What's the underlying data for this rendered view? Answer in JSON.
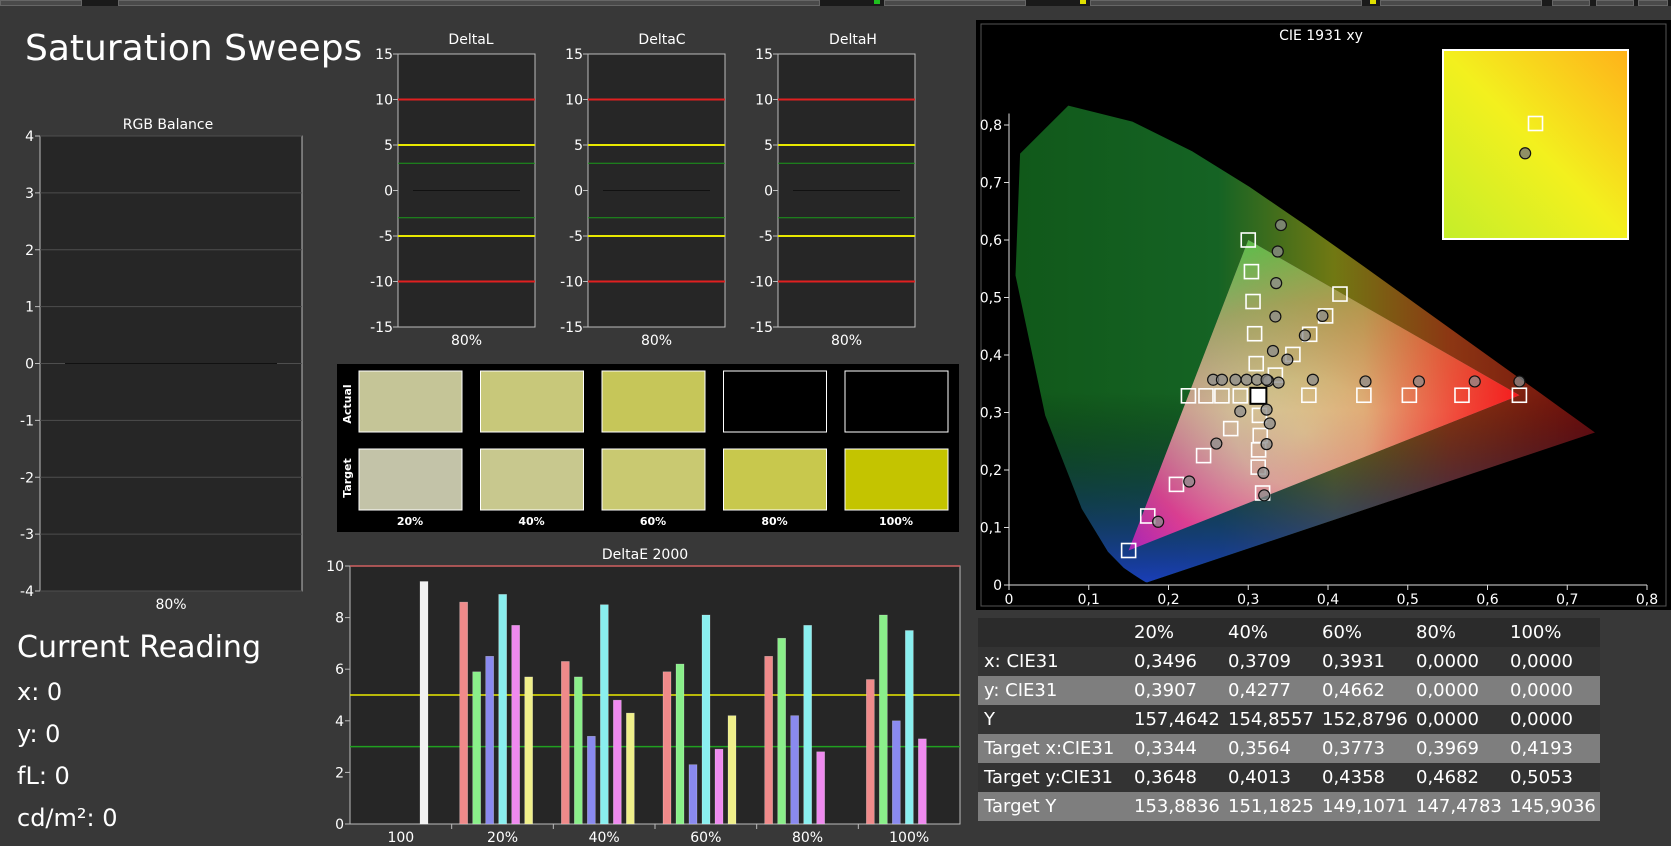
{
  "page_title": "Saturation Sweeps",
  "colors": {
    "background": "#383838",
    "red": "#e02020",
    "yellow": "#e8e800",
    "green": "#20c020"
  },
  "rgb_balance": {
    "title": "RGB Balance",
    "yticks": [
      "4",
      "3",
      "2",
      "1",
      "0",
      "-1",
      "-2",
      "-3",
      "-4"
    ],
    "xlabel": "80%"
  },
  "delta_charts": [
    {
      "title": "DeltaL",
      "xlabel": "80%"
    },
    {
      "title": "DeltaC",
      "xlabel": "80%"
    },
    {
      "title": "DeltaH",
      "xlabel": "80%"
    }
  ],
  "delta_yticks": [
    "15",
    "10",
    "5",
    "0",
    "-5",
    "-10",
    "-15"
  ],
  "swatches": {
    "row_labels": [
      "Actual",
      "Target"
    ],
    "levels": [
      "20%",
      "40%",
      "60%",
      "80%",
      "100%"
    ],
    "actual_colors": [
      "#c5c597",
      "#c8c87a",
      "#c6c659",
      "#000000",
      "#000000"
    ],
    "target_colors": [
      "#c3c3a8",
      "#c8c88e",
      "#c9c971",
      "#c8c84d",
      "#c4c400"
    ]
  },
  "current_reading": {
    "title": "Current Reading",
    "rows": [
      "x: 0",
      "y: 0",
      "fL: 0",
      "cd/m²: 0"
    ]
  },
  "table": {
    "headers": [
      "",
      "20%",
      "40%",
      "60%",
      "80%",
      "100%"
    ],
    "rows": [
      {
        "label": "x: CIE31",
        "values": [
          "0,3496",
          "0,3709",
          "0,3931",
          "0,0000",
          "0,0000"
        ]
      },
      {
        "label": "y: CIE31",
        "values": [
          "0,3907",
          "0,4277",
          "0,4662",
          "0,0000",
          "0,0000"
        ]
      },
      {
        "label": "Y",
        "values": [
          "157,4642",
          "154,8557",
          "152,8796",
          "0,0000",
          "0,0000"
        ]
      },
      {
        "label": "Target x:CIE31",
        "values": [
          "0,3344",
          "0,3564",
          "0,3773",
          "0,3969",
          "0,4193"
        ]
      },
      {
        "label": "Target y:CIE31",
        "values": [
          "0,3648",
          "0,4013",
          "0,4358",
          "0,4682",
          "0,5053"
        ]
      },
      {
        "label": "Target Y",
        "values": [
          "153,8836",
          "151,1825",
          "149,1071",
          "147,4783",
          "145,9036"
        ]
      }
    ]
  },
  "chart_data": [
    {
      "type": "bar",
      "title": "DeltaE 2000",
      "categories": [
        "100",
        "20%",
        "40%",
        "60%",
        "80%",
        "100%"
      ],
      "ylim": [
        0,
        10
      ],
      "yticks": [
        "10",
        "8",
        "6",
        "4",
        "2",
        "0"
      ],
      "threshold_lines": [
        5,
        3
      ],
      "series": [
        {
          "color": "#f2f2f2",
          "values": [
            9.4,
            0,
            0,
            0,
            0,
            0
          ]
        },
        {
          "color": "#ef8a8a",
          "values": [
            0,
            8.6,
            6.3,
            5.9,
            6.5,
            5.6
          ]
        },
        {
          "color": "#8aef8a",
          "values": [
            0,
            5.9,
            5.7,
            6.2,
            7.2,
            8.1
          ]
        },
        {
          "color": "#8a8aef",
          "values": [
            0,
            6.5,
            3.4,
            2.3,
            4.2,
            4.0
          ]
        },
        {
          "color": "#8aefef",
          "values": [
            0,
            8.9,
            8.5,
            8.1,
            7.7,
            7.5
          ]
        },
        {
          "color": "#ef8aef",
          "values": [
            0,
            7.7,
            4.8,
            2.9,
            2.8,
            3.3
          ]
        },
        {
          "color": "#efef8a",
          "values": [
            0,
            5.7,
            4.3,
            4.2,
            0,
            0
          ]
        }
      ]
    },
    {
      "type": "scatter",
      "title": "CIE 1931 xy",
      "xlim": [
        0,
        0.8
      ],
      "ylim": [
        0,
        0.8
      ],
      "xticks": [
        "0",
        "0,1",
        "0,2",
        "0,3",
        "0,4",
        "0,5",
        "0,6",
        "0,7",
        "0,8"
      ],
      "yticks": [
        "0,8",
        "0,7",
        "0,6",
        "0,5",
        "0,4",
        "0,3",
        "0,2",
        "0,1",
        "0"
      ],
      "gamut_triangle": [
        [
          0.64,
          0.33
        ],
        [
          0.3,
          0.6
        ],
        [
          0.15,
          0.06
        ]
      ],
      "white_point": [
        0.3127,
        0.329
      ],
      "targets": [
        [
          0.3,
          0.6
        ],
        [
          0.304,
          0.545
        ],
        [
          0.306,
          0.493
        ],
        [
          0.308,
          0.437
        ],
        [
          0.31,
          0.385
        ],
        [
          0.415,
          0.506
        ],
        [
          0.397,
          0.468
        ],
        [
          0.377,
          0.436
        ],
        [
          0.356,
          0.401
        ],
        [
          0.334,
          0.365
        ],
        [
          0.64,
          0.33
        ],
        [
          0.568,
          0.33
        ],
        [
          0.502,
          0.33
        ],
        [
          0.445,
          0.33
        ],
        [
          0.376,
          0.33
        ],
        [
          0.3125,
          0.205
        ],
        [
          0.315,
          0.26
        ],
        [
          0.314,
          0.295
        ],
        [
          0.318,
          0.16
        ],
        [
          0.313,
          0.235
        ],
        [
          0.15,
          0.06
        ],
        [
          0.174,
          0.12
        ],
        [
          0.21,
          0.175
        ],
        [
          0.244,
          0.225
        ],
        [
          0.278,
          0.272
        ],
        [
          0.225,
          0.329
        ],
        [
          0.247,
          0.329
        ],
        [
          0.267,
          0.329
        ],
        [
          0.29,
          0.329
        ]
      ],
      "measured": [
        [
          0.341,
          0.626
        ],
        [
          0.337,
          0.58
        ],
        [
          0.335,
          0.525
        ],
        [
          0.334,
          0.467
        ],
        [
          0.331,
          0.407
        ],
        [
          0.393,
          0.468
        ],
        [
          0.371,
          0.434
        ],
        [
          0.349,
          0.392
        ],
        [
          0.325,
          0.355
        ],
        [
          0.64,
          0.354
        ],
        [
          0.584,
          0.354
        ],
        [
          0.514,
          0.354
        ],
        [
          0.447,
          0.354
        ],
        [
          0.381,
          0.357
        ],
        [
          0.338,
          0.352
        ],
        [
          0.319,
          0.195
        ],
        [
          0.323,
          0.245
        ],
        [
          0.327,
          0.281
        ],
        [
          0.32,
          0.156
        ],
        [
          0.323,
          0.305
        ],
        [
          0.187,
          0.11
        ],
        [
          0.226,
          0.18
        ],
        [
          0.26,
          0.246
        ],
        [
          0.29,
          0.302
        ],
        [
          0.256,
          0.357
        ],
        [
          0.267,
          0.357
        ],
        [
          0.284,
          0.357
        ],
        [
          0.298,
          0.357
        ],
        [
          0.311,
          0.357
        ],
        [
          0.323,
          0.357
        ]
      ],
      "inset_measured": [
        0.3496,
        0.3907
      ],
      "inset_target": [
        0.3344,
        0.3648
      ]
    }
  ]
}
